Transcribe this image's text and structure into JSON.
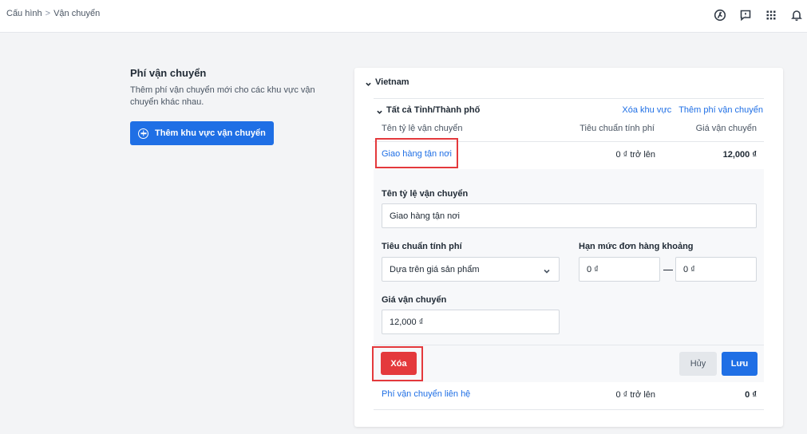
{
  "breadcrumb": {
    "root": "Cấu hình",
    "separator": ">",
    "current": "Vận chuyển"
  },
  "header_icons": [
    "history-icon",
    "feedback-icon",
    "apps-grid-icon",
    "bell-icon"
  ],
  "intro": {
    "title": "Phí vận chuyển",
    "description": "Thêm phí vận chuyển mới cho các khu vực vận chuyển khác nhau.",
    "add_area_label": "Thêm khu vực vận chuyển"
  },
  "zone": {
    "country": "Vietnam",
    "region": "Tất cả Tỉnh/Thành phố",
    "delete_zone_label": "Xóa khu vực",
    "add_rate_label": "Thêm phí vận chuyển",
    "columns": {
      "name": "Tên tỷ lệ vận chuyển",
      "condition": "Tiêu chuẩn tính phí",
      "price": "Giá vận chuyển"
    },
    "rates": [
      {
        "name": "Giao hàng tận nơi",
        "condition": "0 ₫ trở lên",
        "price": "12,000 ₫"
      },
      {
        "name": "Phí vận chuyển liên hệ",
        "condition": "0 ₫ trở lên",
        "price": "0 ₫"
      }
    ]
  },
  "edit_form": {
    "name_label": "Tên tỷ lệ vận chuyển",
    "name_value": "Giao hàng tận nơi",
    "criteria_label": "Tiêu chuẩn tính phí",
    "criteria_value": "Dựa trên giá sản phẩm",
    "range_label": "Hạn mức đơn hàng khoảng",
    "range_min": "0 ₫",
    "range_max": "0 ₫",
    "price_label": "Giá vận chuyển",
    "price_value": "12,000 ₫",
    "delete_label": "Xóa",
    "cancel_label": "Hủy",
    "save_label": "Lưu"
  },
  "colors": {
    "primary": "#1f6fe5",
    "danger": "#e4393c",
    "highlight": "#e4393c"
  }
}
